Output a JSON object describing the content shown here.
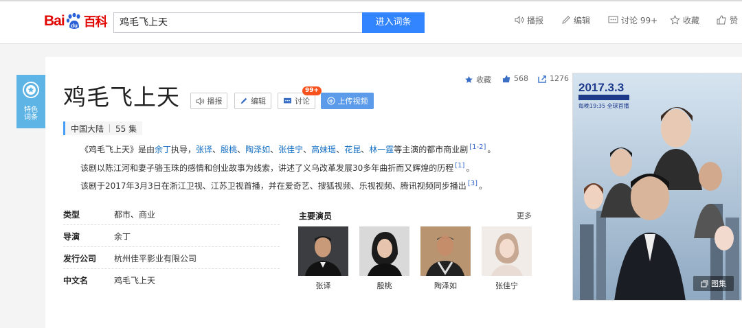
{
  "header": {
    "logo_text_1": "Bai",
    "logo_text_2": "百科",
    "search_value": "鸡毛飞上天",
    "search_button": "进入词条",
    "actions": [
      {
        "label": "播报",
        "icon": "speaker-icon"
      },
      {
        "label": "编辑",
        "icon": "pencil-icon"
      },
      {
        "label": "讨论 99+",
        "icon": "comment-icon"
      },
      {
        "label": "收藏",
        "icon": "star-icon"
      },
      {
        "label": "赞",
        "icon": "thumbs-up-icon"
      }
    ]
  },
  "badge": {
    "line1": "特色",
    "line2": "词条"
  },
  "entry": {
    "title": "鸡毛飞上天",
    "buttons": {
      "broadcast": "播报",
      "edit": "编辑",
      "discuss": "讨论",
      "discuss_badge": "99+",
      "upload_video": "上传视频"
    },
    "stats": {
      "favorite": "收藏",
      "likes": "568",
      "shares": "1276"
    },
    "meta": {
      "region": "中国大陆",
      "episodes": "55 集"
    },
    "summary": {
      "p1_prefix": "《鸡毛飞上天》是由",
      "director": "余丁",
      "p1_mid": "执导，",
      "actors_linked": [
        "张译",
        "殷桃",
        "陶泽如",
        "张佳宁",
        "高妹瑶",
        "花昆",
        "林一霆"
      ],
      "actor_sep": "、",
      "p1_suffix": "等主演的都市商业剧",
      "ref1": "[1-2]",
      "end": "。",
      "p2": "该剧以陈江河和妻子骆玉珠的感情和创业故事为线索，讲述了义乌改革发展30多年曲折而又辉煌的历程",
      "ref2": "[1]",
      "p3": "该剧于2017年3月3日在浙江卫视、江苏卫视首播，并在爱奇艺、搜狐视频、乐视视频、腾讯视频同步播出",
      "ref3": "[3]"
    },
    "info": [
      {
        "key": "类型",
        "value": "都市、商业"
      },
      {
        "key": "导演",
        "value": "余丁"
      },
      {
        "key": "发行公司",
        "value": "杭州佳平影业有限公司"
      },
      {
        "key": "中文名",
        "value": "鸡毛飞上天"
      }
    ],
    "cast": {
      "title": "主要演员",
      "more": "更多",
      "actors": [
        "张译",
        "殷桃",
        "陶泽如",
        "张佳宁"
      ]
    },
    "poster": {
      "date": "2017.3.3",
      "schedule": "每晚19:35 全球首播",
      "gallery": "图集"
    }
  },
  "colors": {
    "accent": "#3385ff",
    "brand_red": "#e10601",
    "link": "#136ec2",
    "badge_blue": "#5fb4e6"
  }
}
